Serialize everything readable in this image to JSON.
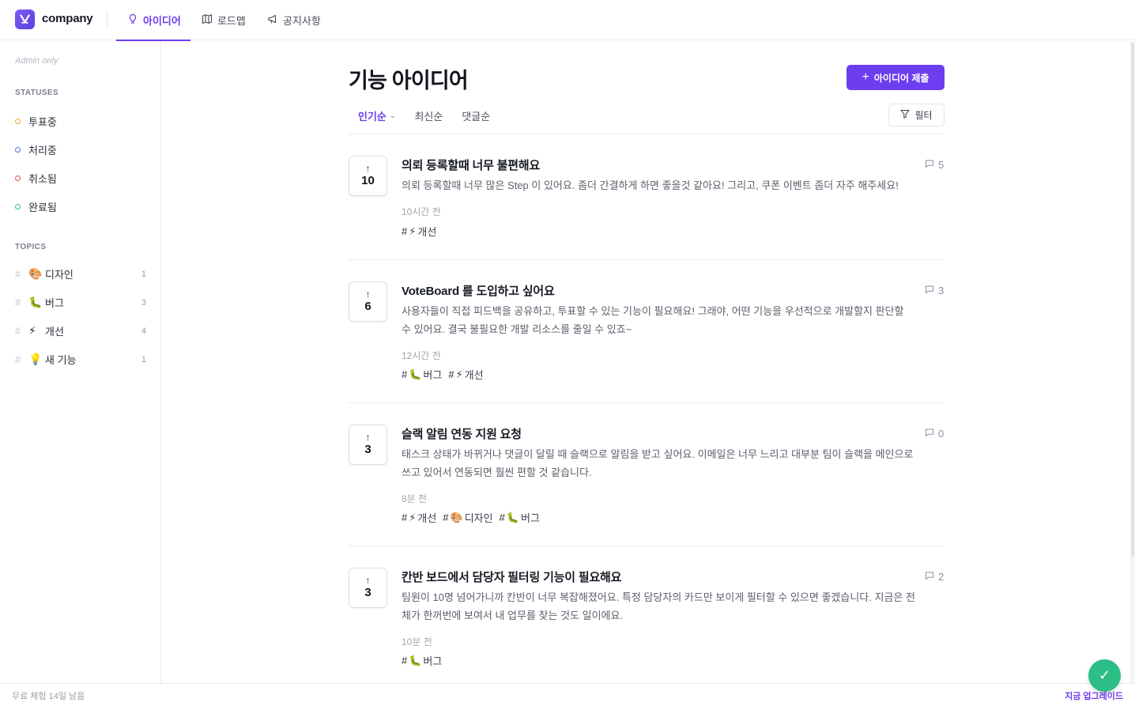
{
  "header": {
    "brand": "company",
    "tabs": [
      {
        "label": "아이디어",
        "icon": "lightbulb-icon",
        "active": true
      },
      {
        "label": "로드맵",
        "icon": "map-icon",
        "active": false
      },
      {
        "label": "공지사항",
        "icon": "megaphone-icon",
        "active": false
      }
    ]
  },
  "sidebar": {
    "admin_note": "Admin only",
    "statuses_title": "STATUSES",
    "statuses": [
      {
        "label": "투표중",
        "color": "#f0a32c"
      },
      {
        "label": "처리중",
        "color": "#4c7be8"
      },
      {
        "label": "취소됨",
        "color": "#e8514c"
      },
      {
        "label": "완료됨",
        "color": "#2bbf85"
      }
    ],
    "topics_title": "TOPICS",
    "topics": [
      {
        "hash": "#",
        "emoji": "🎨",
        "label": "디자인",
        "count": "1"
      },
      {
        "hash": "#",
        "emoji": "🐛",
        "label": "버그",
        "count": "3"
      },
      {
        "hash": "#",
        "emoji": "⚡",
        "label": "개선",
        "count": "4"
      },
      {
        "hash": "#",
        "emoji": "💡",
        "label": "새 기능",
        "count": "1"
      }
    ]
  },
  "main": {
    "title": "기능 아이디어",
    "submit_label": "아이디어 제출",
    "sort_tabs": [
      {
        "label": "인기순",
        "active": true
      },
      {
        "label": "최신순",
        "active": false
      },
      {
        "label": "댓글순",
        "active": false
      }
    ],
    "filter_label": "필터",
    "posts": [
      {
        "votes": "10",
        "title": "의뢰 등록할때 너무 불편해요",
        "body": "의뢰 등록할때 너무 많은 Step 이 있어요. 좀더 간결하게 하면 좋을것 같아요! 그리고, 쿠폰 이벤트 좀더 자주 해주세요!",
        "time": "10시간 전",
        "comments": "5",
        "tags": [
          {
            "emoji": "⚡",
            "label": "개선"
          }
        ]
      },
      {
        "votes": "6",
        "title": "VoteBoard 를 도입하고 싶어요",
        "body": "사용자들이 직접 피드백을 공유하고, 투표할 수 있는 기능이 필요해요! 그래야, 어떤 기능을 우선적으로 개발할지 판단할 수 있어요. 결국 불필요한 개발 리소스를 줄일 수 있죠~",
        "time": "12시간 전",
        "comments": "3",
        "tags": [
          {
            "emoji": "🐛",
            "label": "버그"
          },
          {
            "emoji": "⚡",
            "label": "개선"
          }
        ]
      },
      {
        "votes": "3",
        "title": "슬랙 알림 연동 지원 요청",
        "body": "태스크 상태가 바뀌거나 댓글이 달릴 때 슬랙으로 알림을 받고 싶어요. 이메일은 너무 느리고 대부분 팀이 슬랙을 메인으로 쓰고 있어서 연동되면 훨씬 편할 것 같습니다.",
        "time": "8분 전",
        "comments": "0",
        "tags": [
          {
            "emoji": "⚡",
            "label": "개선"
          },
          {
            "emoji": "🎨",
            "label": "디자인"
          },
          {
            "emoji": "🐛",
            "label": "버그"
          }
        ]
      },
      {
        "votes": "3",
        "title": "칸반 보드에서 담당자 필터링 기능이 필요해요",
        "body": "팀원이 10명 넘어가니까 칸반이 너무 복잡해졌어요. 특정 담당자의 카드만 보이게 필터할 수 있으면 좋겠습니다. 지금은 전체가 한꺼번에 보여서 내 업무를 찾는 것도 일이에요.",
        "time": "10분 전",
        "comments": "2",
        "tags": [
          {
            "emoji": "🐛",
            "label": "버그"
          }
        ]
      }
    ]
  },
  "footer": {
    "trial_text": "무료 체험 14일 남음",
    "upgrade_label": "지금 업그레이드"
  },
  "colors": {
    "accent": "#6d3df0",
    "success": "#2bbf85"
  }
}
